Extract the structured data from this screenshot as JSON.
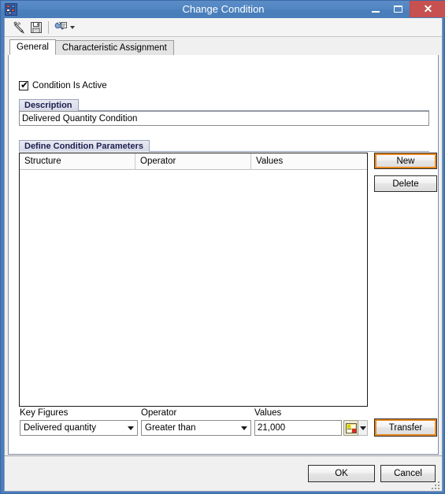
{
  "window": {
    "title": "Change Condition",
    "icon": "app-icon",
    "caption_buttons": {
      "minimize": "─",
      "maximize": "□",
      "close": "✕"
    }
  },
  "toolbar": {
    "items": [
      {
        "name": "check-entries-icon",
        "tooltip": "Check"
      },
      {
        "name": "save-icon",
        "tooltip": "Save"
      },
      {
        "name": "settings-wrench-icon",
        "tooltip": "Settings"
      }
    ]
  },
  "tabs": [
    {
      "id": "general",
      "label": "General",
      "active": true
    },
    {
      "id": "characteristic-assignment",
      "label": "Characteristic Assignment",
      "active": false
    }
  ],
  "general": {
    "condition_active": {
      "label": "Condition Is Active",
      "checked": true,
      "check_glyph": "✔"
    },
    "description_group": {
      "header": "Description",
      "value": "Delivered Quantity Condition",
      "placeholder": ""
    },
    "parameters_group": {
      "header": "Define Condition Parameters",
      "table": {
        "columns": [
          "Structure",
          "Operator",
          "Values"
        ],
        "rows": []
      },
      "buttons": {
        "new": "New",
        "delete": "Delete"
      }
    },
    "entry_row": {
      "key_figures": {
        "label": "Key Figures",
        "value": "Delivered quantity"
      },
      "operator": {
        "label": "Operator",
        "value": "Greater than"
      },
      "values": {
        "label": "Values",
        "value": "21,000",
        "value_help_icon": "value-help-icon",
        "dropdown_icon": "chevron-down-icon"
      },
      "transfer_button": "Transfer"
    }
  },
  "footer": {
    "ok": "OK",
    "cancel": "Cancel"
  },
  "colors": {
    "titlebar": "#4a7ebb",
    "close_button": "#c75050",
    "focus_outline": "#e8861e",
    "group_header_text": "#1d1d4f",
    "page_background": "#ffffff"
  }
}
